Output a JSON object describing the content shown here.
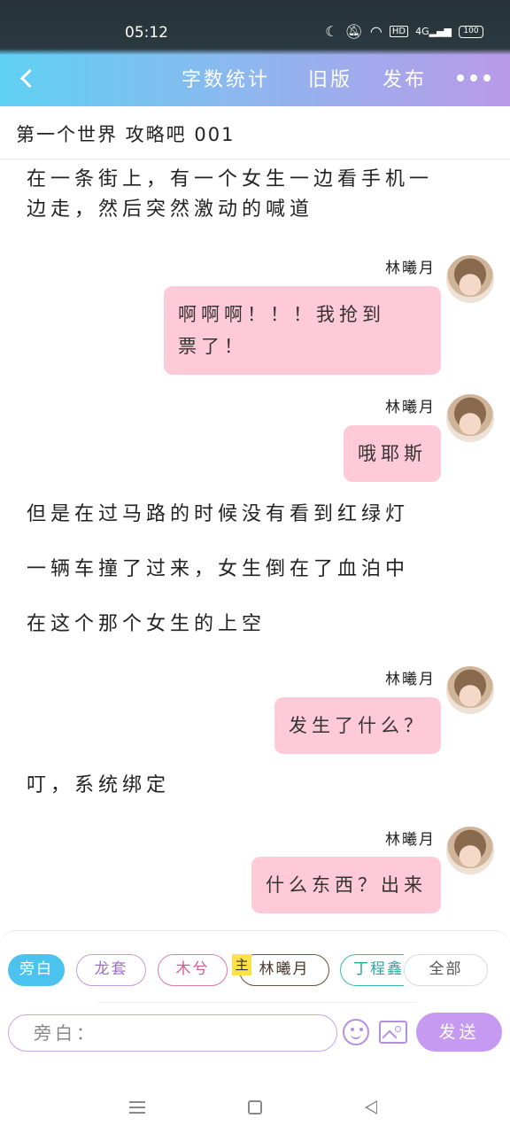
{
  "status_bar": {
    "time": "05:12",
    "battery": "100",
    "network": "4G",
    "hd": "HD"
  },
  "header": {
    "word_count": "字数统计",
    "old_version": "旧版",
    "publish": "发布"
  },
  "story_title": "第一个世界 攻略吧 001",
  "messages": {
    "n1_line1": "在一条街上，有一个女生一边看手机一",
    "n1_line2": "边走，然后突然激动的喊道",
    "d1_speaker": "林曦月",
    "d1_text_line1": "啊啊啊！！！我抢到",
    "d1_text_line2": "票了！",
    "d2_speaker": "林曦月",
    "d2_text": "哦耶斯",
    "n2": "但是在过马路的时候没有看到红绿灯",
    "n3": "一辆车撞了过来，女生倒在了血泊中",
    "n4": "在这个那个女生的上空",
    "d3_speaker": "林曦月",
    "d3_text": "发生了什么？",
    "n5": "叮，系统绑定",
    "d4_speaker": "林曦月",
    "d4_text": "什么东西？出来"
  },
  "characters": {
    "narrator": "旁白",
    "c1": "龙套",
    "c2": "木兮",
    "main_tag": "主",
    "c3": "林曦月",
    "c4": "丁程鑫",
    "all": "全部"
  },
  "composer": {
    "placeholder": "旁白：",
    "send": "发送"
  },
  "colors": {
    "header_gradient_start": "#5fd0f2",
    "header_gradient_end": "#b99ae8",
    "bubble": "#ffcad7",
    "send_button": "#c69af0",
    "narrator_chip": "#4cc3ef"
  }
}
